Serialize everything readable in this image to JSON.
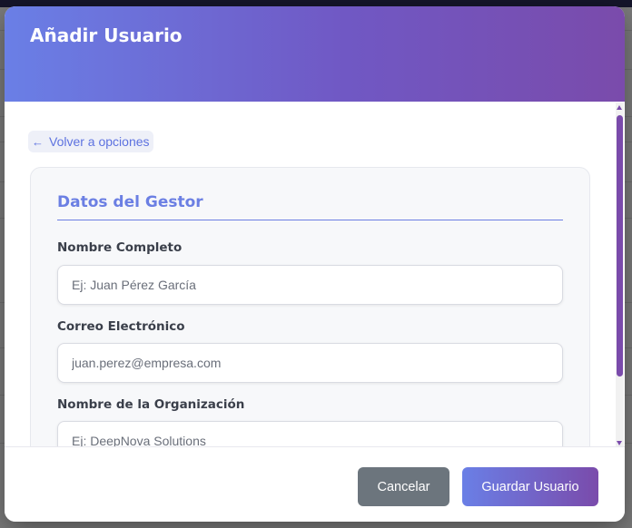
{
  "modal": {
    "title": "Añadir Usuario",
    "back_link": "Volver a opciones",
    "section_title": "Datos del Gestor"
  },
  "fields": {
    "name": {
      "label": "Nombre Completo",
      "placeholder": "Ej: Juan Pérez García"
    },
    "email": {
      "label": "Correo Electrónico",
      "placeholder": "juan.perez@empresa.com"
    },
    "organization": {
      "label": "Nombre de la Organización",
      "placeholder": "Ej: DeepNova Solutions"
    }
  },
  "footer": {
    "cancel_label": "Cancelar",
    "save_label": "Guardar Usuario"
  },
  "colors": {
    "accent": "#6b7fe3",
    "header_gradient_start": "#6a7fe6",
    "header_gradient_end": "#7a4bab",
    "cancel_button": "#6c757d"
  }
}
